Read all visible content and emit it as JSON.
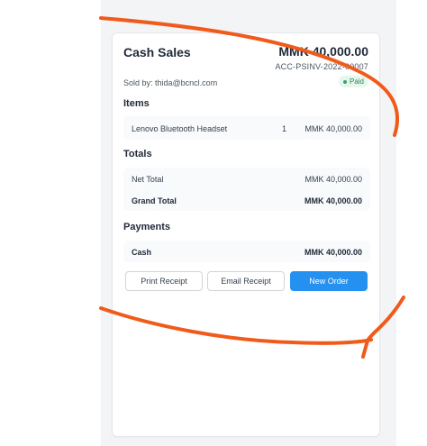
{
  "header": {
    "title": "Cash Sales",
    "amount": "MMK 40,000.00",
    "invoice": "ACC-PSINV-2022-00007",
    "sold_by": "Sold by: thida@bcncl.com",
    "status": "Paid"
  },
  "items": {
    "title": "Items",
    "rows": [
      {
        "name": "Lenovo Bluetooth Headset",
        "qty": "1",
        "amount": "MMK 40,000.00"
      }
    ]
  },
  "totals": {
    "title": "Totals",
    "net_label": "Net Total",
    "net_value": "MMK 40,000.00",
    "grand_label": "Grand Total",
    "grand_value": "MMK 40,000.00"
  },
  "payments": {
    "title": "Payments",
    "method": "Cash",
    "value": "MMK 40,000.00"
  },
  "actions": {
    "print": "Print Receipt",
    "email": "Email Receipt",
    "new_order": "New Order"
  },
  "colors": {
    "primary": "#2490ef",
    "paid_badge_bg": "#e7f6ec",
    "paid_badge_text": "#2f855a",
    "annotation": "#f05a1a"
  }
}
